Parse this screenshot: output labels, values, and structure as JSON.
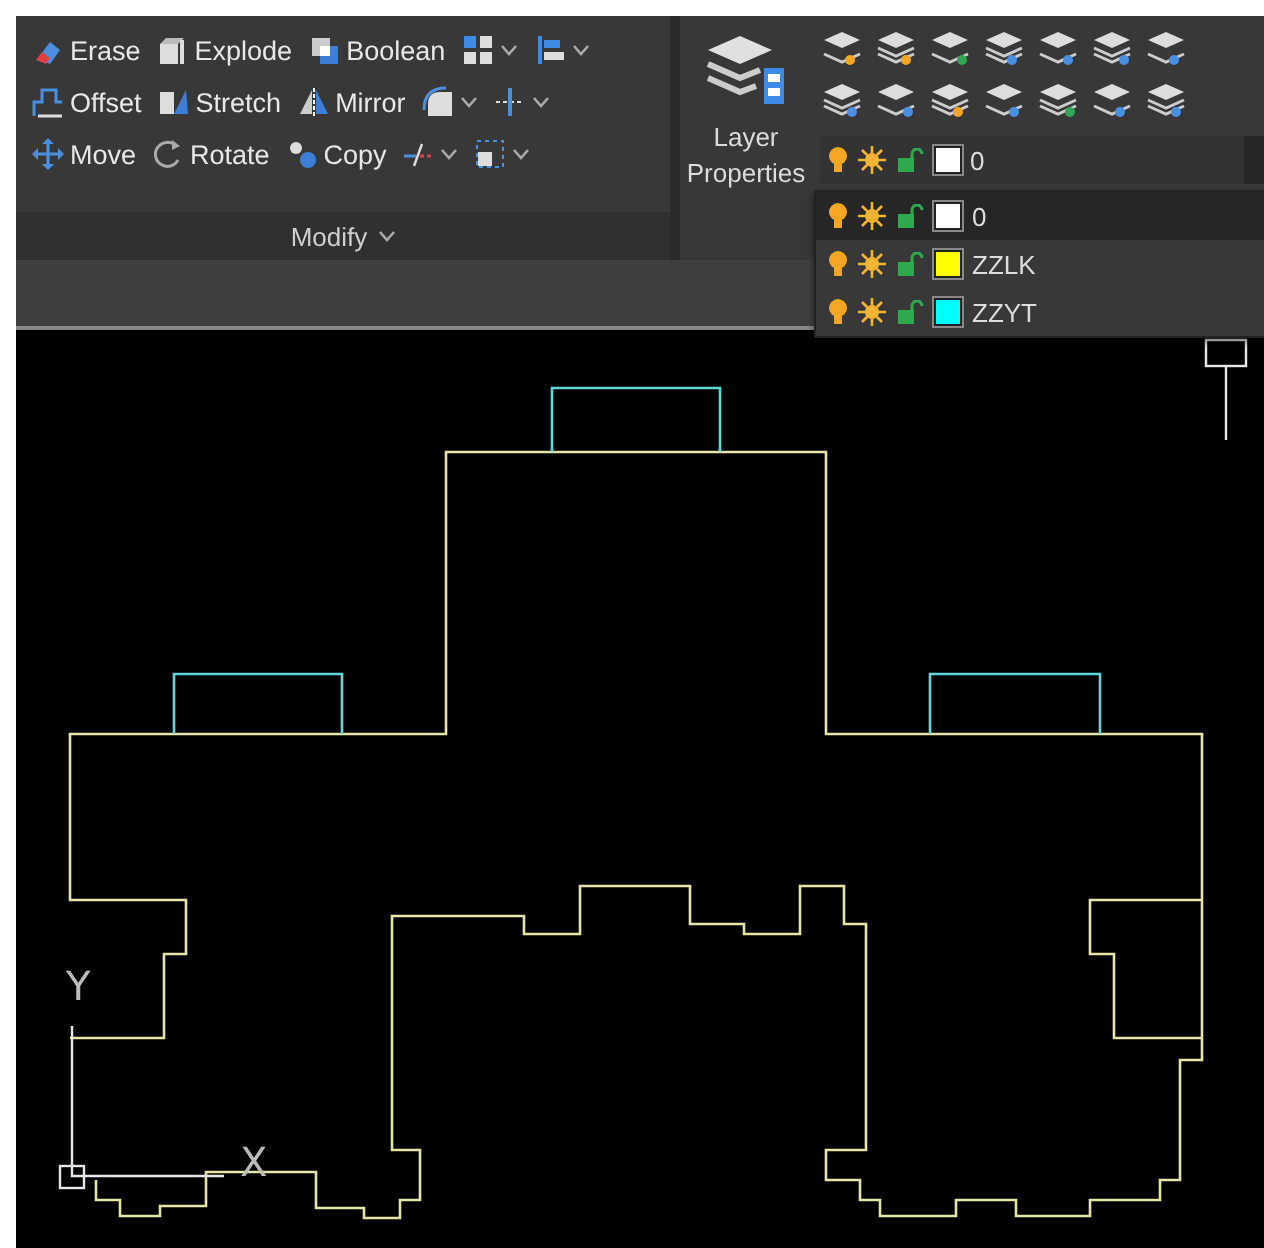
{
  "modify_panel": {
    "title": "Modify",
    "rows": [
      [
        {
          "kind": "tool",
          "label": "Erase"
        },
        {
          "kind": "tool",
          "label": "Explode"
        },
        {
          "kind": "tool",
          "label": "Boolean"
        },
        {
          "kind": "dropdown"
        },
        {
          "kind": "dropdown"
        }
      ],
      [
        {
          "kind": "tool",
          "label": "Offset"
        },
        {
          "kind": "tool",
          "label": "Stretch"
        },
        {
          "kind": "tool",
          "label": "Mirror"
        },
        {
          "kind": "dropdown"
        },
        {
          "kind": "dropdown"
        }
      ],
      [
        {
          "kind": "tool",
          "label": "Move"
        },
        {
          "kind": "tool",
          "label": "Rotate"
        },
        {
          "kind": "tool",
          "label": "Copy"
        },
        {
          "kind": "dropdown"
        },
        {
          "kind": "dropdown"
        }
      ]
    ]
  },
  "layers_panel": {
    "properties_button": "Layer Properties",
    "current_layer": {
      "name": "0",
      "color": "#ffffff",
      "on": true,
      "frozen": false,
      "locked": false
    },
    "layer_list": [
      {
        "name": "0",
        "color": "#ffffff",
        "on": true,
        "frozen": false,
        "locked": false,
        "selected": true
      },
      {
        "name": "ZZLK",
        "color": "#ffff00",
        "on": true,
        "frozen": false,
        "locked": false,
        "selected": false
      },
      {
        "name": "ZZYT",
        "color": "#00ffff",
        "on": true,
        "frozen": false,
        "locked": false,
        "selected": false
      }
    ]
  },
  "drawing": {
    "ucs_x_label": "X",
    "ucs_y_label": "Y"
  }
}
